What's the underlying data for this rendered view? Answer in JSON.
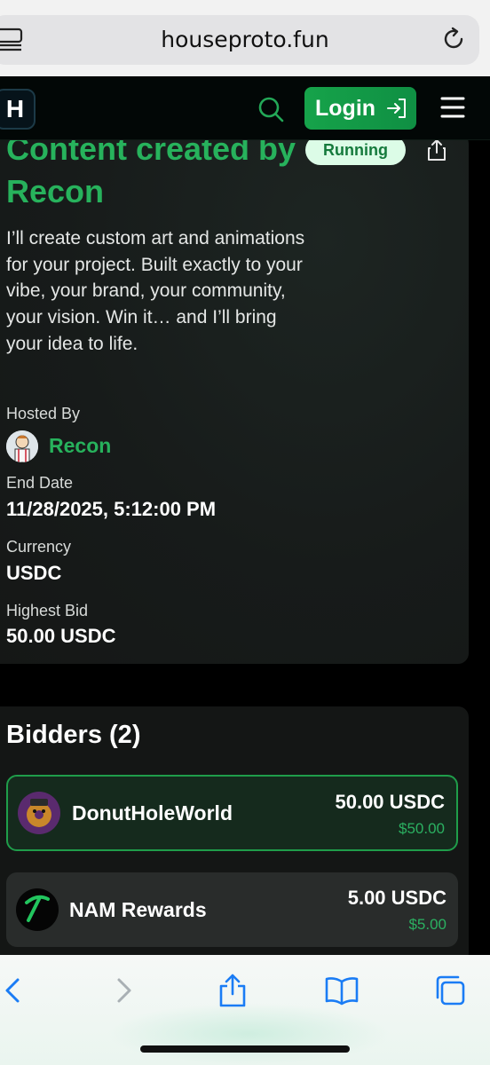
{
  "browser": {
    "url": "houseproto.fun"
  },
  "header": {
    "logo_letter": "H",
    "login_label": "Login"
  },
  "auction": {
    "title": "Content created by Recon",
    "status": "Running",
    "description": "I’ll create custom art and animations for your project. Built exactly to your vibe, your brand, your community, your vision. Win it… and I’ll bring your idea to life.",
    "hosted_by_label": "Hosted By",
    "host_name": "Recon",
    "end_date_label": "End Date",
    "end_date": "11/28/2025, 5:12:00 PM",
    "currency_label": "Currency",
    "currency": "USDC",
    "highest_bid_label": "Highest Bid",
    "highest_bid": "50.00 USDC"
  },
  "bidders": {
    "title": "Bidders (2)",
    "items": [
      {
        "name": "DonutHoleWorld",
        "amount": "50.00 USDC",
        "usd": "$50.00"
      },
      {
        "name": "NAM Rewards",
        "amount": "5.00 USDC",
        "usd": "$5.00"
      }
    ]
  },
  "colors": {
    "accent_green": "#27b25c",
    "status_bg": "#dcfce7",
    "safari_blue": "#1a7cf5"
  },
  "icons": [
    "tabs-icon",
    "reload-icon",
    "search-icon",
    "login-arrow-icon",
    "menu-icon",
    "share-icon",
    "back-icon",
    "forward-icon",
    "bookmarks-icon",
    "tabs-overview-icon"
  ]
}
